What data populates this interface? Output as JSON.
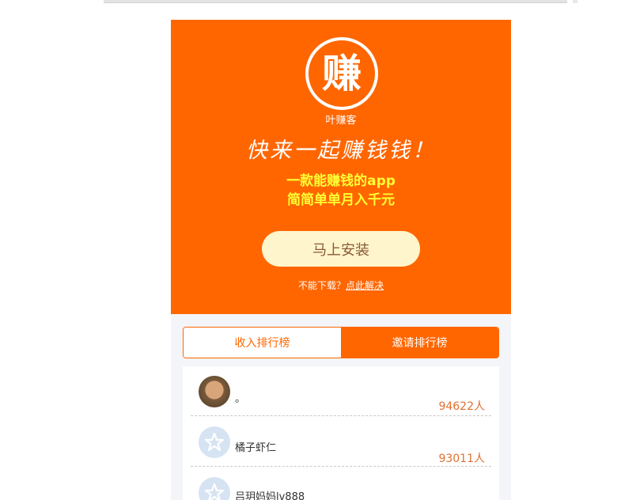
{
  "brand": {
    "logo_char": "赚",
    "app_name": "叶赚客"
  },
  "hero": {
    "slogan": "快来一起赚钱钱！",
    "sub_line_1": "一款能赚钱的app",
    "sub_line_2": "简简单单月入千元",
    "install_label": "马上安装",
    "help_text": "不能下载？",
    "help_link": "点此解决"
  },
  "tabs": [
    {
      "label": "收入排行榜",
      "active": false
    },
    {
      "label": "邀请排行榜",
      "active": true
    }
  ],
  "ranking": [
    {
      "name": "。",
      "count": "94622人",
      "avatar": "photo"
    },
    {
      "name": "橘子虾仁",
      "count": "93011人",
      "avatar": "default-star-icon"
    },
    {
      "name": "吕玥妈妈lv888",
      "count": "",
      "avatar": "default-star-icon"
    }
  ],
  "colors": {
    "brand_orange": "#ff6600",
    "highlight_yellow": "#ffff33",
    "button_cream": "#fff5cc",
    "count_orange": "#e07030"
  }
}
